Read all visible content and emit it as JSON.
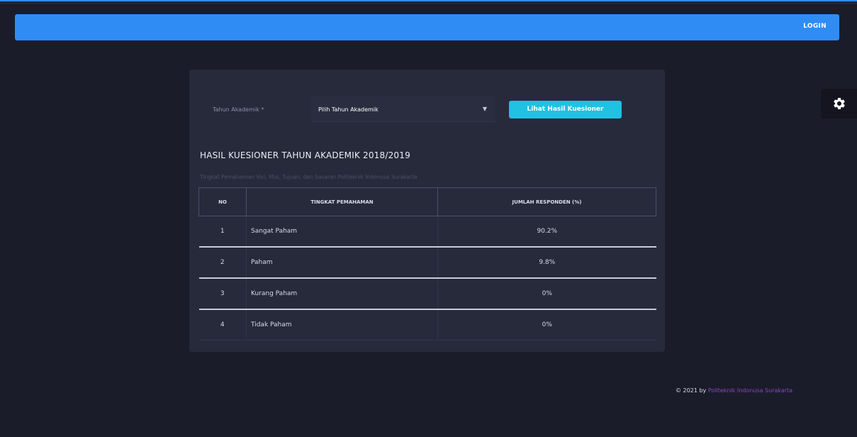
{
  "navbar": {
    "login_label": "LOGIN"
  },
  "form": {
    "label": "Tahun Akademik *",
    "select_value": "Pilih Tahun Akademik",
    "button_label": "Lihat Hasil Kuesioner"
  },
  "result": {
    "title": "HASIL KUESIONER TAHUN AKADEMIK 2018/2019",
    "subtitle": "Tingkat Pemahaman Visi, Misi, Tujuan, dan Sasaran Politeknik Indonusa Surakarta"
  },
  "table": {
    "headers": [
      "NO",
      "TINGKAT PEMAHAMAN",
      "JUMLAH RESPONDEN (%)"
    ],
    "rows": [
      [
        "1",
        "Sangat Paham",
        "90.2%"
      ],
      [
        "2",
        "Paham",
        "9.8%"
      ],
      [
        "3",
        "Kurang Paham",
        "0%"
      ],
      [
        "4",
        "Tidak Paham",
        "0%"
      ]
    ]
  },
  "footer": {
    "prefix": "© 2021 by",
    "link": "Politeknik Indonusa Surakarta"
  },
  "icons": {
    "settings": "gear-icon",
    "dropdown": "chevron-down-icon"
  },
  "colors": {
    "accent": "#2f8cf5",
    "button": "#20c1e3",
    "footer_link": "#8b45c9",
    "background": "#1b1c29",
    "card": "#272a3b"
  }
}
